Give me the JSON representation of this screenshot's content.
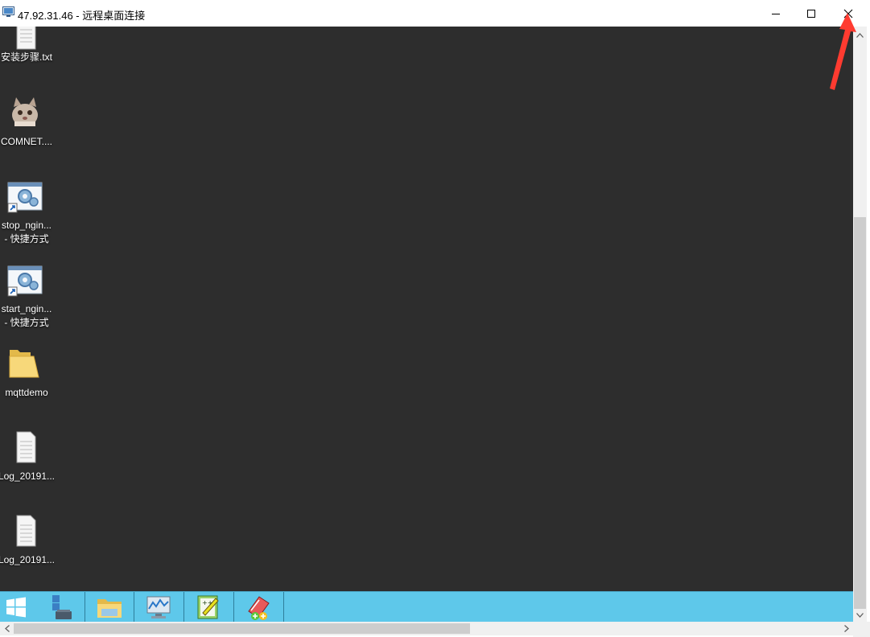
{
  "window": {
    "title": "47.92.31.46 - 远程桌面连接",
    "controls": [
      "minimize-icon",
      "maximize-icon",
      "close-icon"
    ]
  },
  "desktop": {
    "icons": [
      {
        "label": "安装步骤.txt",
        "icon": "text-file-icon"
      },
      {
        "label": "COMNET....",
        "icon": "cat-app-icon"
      },
      {
        "label": "stop_ngin...",
        "label2": "- 快捷方式",
        "icon": "batch-shortcut-icon"
      },
      {
        "label": "start_ngin...",
        "label2": "- 快捷方式",
        "icon": "batch-shortcut-icon"
      },
      {
        "label": "mqttdemo",
        "icon": "folder-icon"
      },
      {
        "label": "Log_20191...",
        "icon": "text-file-icon"
      },
      {
        "label": "Log_20191...",
        "icon": "text-file-icon"
      }
    ]
  },
  "taskbar": {
    "buttons": [
      "windows-start-icon",
      "server-manager-icon",
      "file-explorer-icon",
      "performance-monitor-icon",
      "notepad-plus-icon",
      "add-remove-icon"
    ]
  },
  "colors": {
    "desktop_bg": "#2d2d2d",
    "taskbar_bg": "#5ec8ea",
    "annotation_arrow": "#ff3b30"
  }
}
